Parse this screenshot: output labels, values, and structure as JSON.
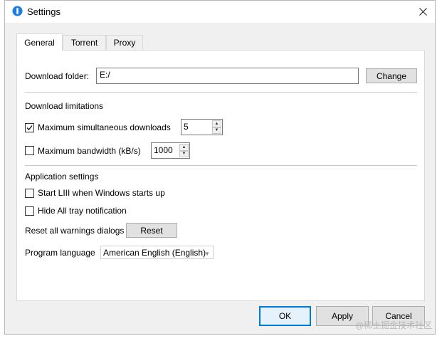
{
  "window": {
    "title": "Settings"
  },
  "tabs": [
    {
      "label": "General",
      "active": true
    },
    {
      "label": "Torrent",
      "active": false
    },
    {
      "label": "Proxy",
      "active": false
    }
  ],
  "general": {
    "download_folder_label": "Download folder:",
    "download_folder_value": "E:/",
    "change_label": "Change",
    "download_limitations_heading": "Download limitations",
    "max_downloads_label": "Maximum simultaneous downloads",
    "max_downloads_checked": true,
    "max_downloads_value": "5",
    "max_bandwidth_label": "Maximum bandwidth (kB/s)",
    "max_bandwidth_checked": false,
    "max_bandwidth_value": "1000",
    "app_settings_heading": "Application settings",
    "start_with_windows_label": "Start LIII when Windows starts up",
    "hide_tray_label": "Hide All tray notification",
    "reset_warnings_label": "Reset all warnings dialogs",
    "reset_label": "Reset",
    "language_label": "Program language",
    "language_value": "American English (English)"
  },
  "footer": {
    "ok_label": "OK",
    "apply_label": "Apply",
    "cancel_label": "Cancel"
  },
  "watermark": "@稀土掘金技术社区",
  "colors": {
    "accent": "#0078d7",
    "window_bg": "#f0f0f0"
  }
}
